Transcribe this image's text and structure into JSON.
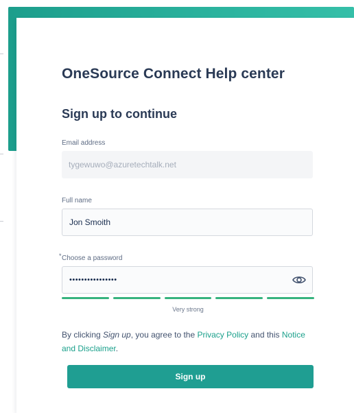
{
  "header": {
    "help_center_title": "OneSource Connect Help center"
  },
  "form": {
    "heading": "Sign up to continue",
    "email": {
      "label": "Email address",
      "value": "tygewuwo@azuretechtalk.net"
    },
    "full_name": {
      "label": "Full name",
      "value": "Jon Smoith"
    },
    "password": {
      "required_marker": "*",
      "label": "Choose a password",
      "value": "••••••••••••••••",
      "visibility_icon": "eye-icon",
      "strength_segments": 5,
      "strength_filled": 5,
      "strength_label": "Very strong"
    },
    "terms": {
      "prefix": "By clicking ",
      "action_word": "Sign up",
      "middle": ", you agree to the ",
      "privacy_link": "Privacy Policy",
      "and_text": " and this ",
      "notice_link": "Notice and Disclaimer",
      "suffix": "."
    },
    "submit_label": "Sign up"
  },
  "colors": {
    "accent": "#1f9e92",
    "frame_teal": "#2bb39e",
    "strength_green": "#36b37e",
    "link": "#1aa08b"
  }
}
